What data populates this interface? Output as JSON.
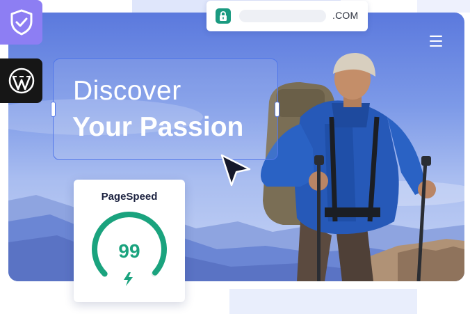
{
  "colors": {
    "accent_purple": "#8d7ef3",
    "wordpress_tile": "#161616",
    "lock_green": "#1a9a80",
    "gauge_green": "#1aa37e",
    "selection_blue": "#5076e8",
    "sky_top": "#5b79dd"
  },
  "browser": {
    "domain_suffix": ".COM",
    "lock_icon": "lock-icon"
  },
  "side_tiles": [
    {
      "icon": "shield-check-icon"
    },
    {
      "icon": "wordpress-icon"
    }
  ],
  "hero": {
    "headline_line1": "Discover",
    "headline_line2": "Your Passion",
    "menu_icon": "hamburger-menu-icon"
  },
  "pagespeed": {
    "title": "PageSpeed",
    "score": "99",
    "score_value": 99,
    "icon": "lightning-icon"
  }
}
